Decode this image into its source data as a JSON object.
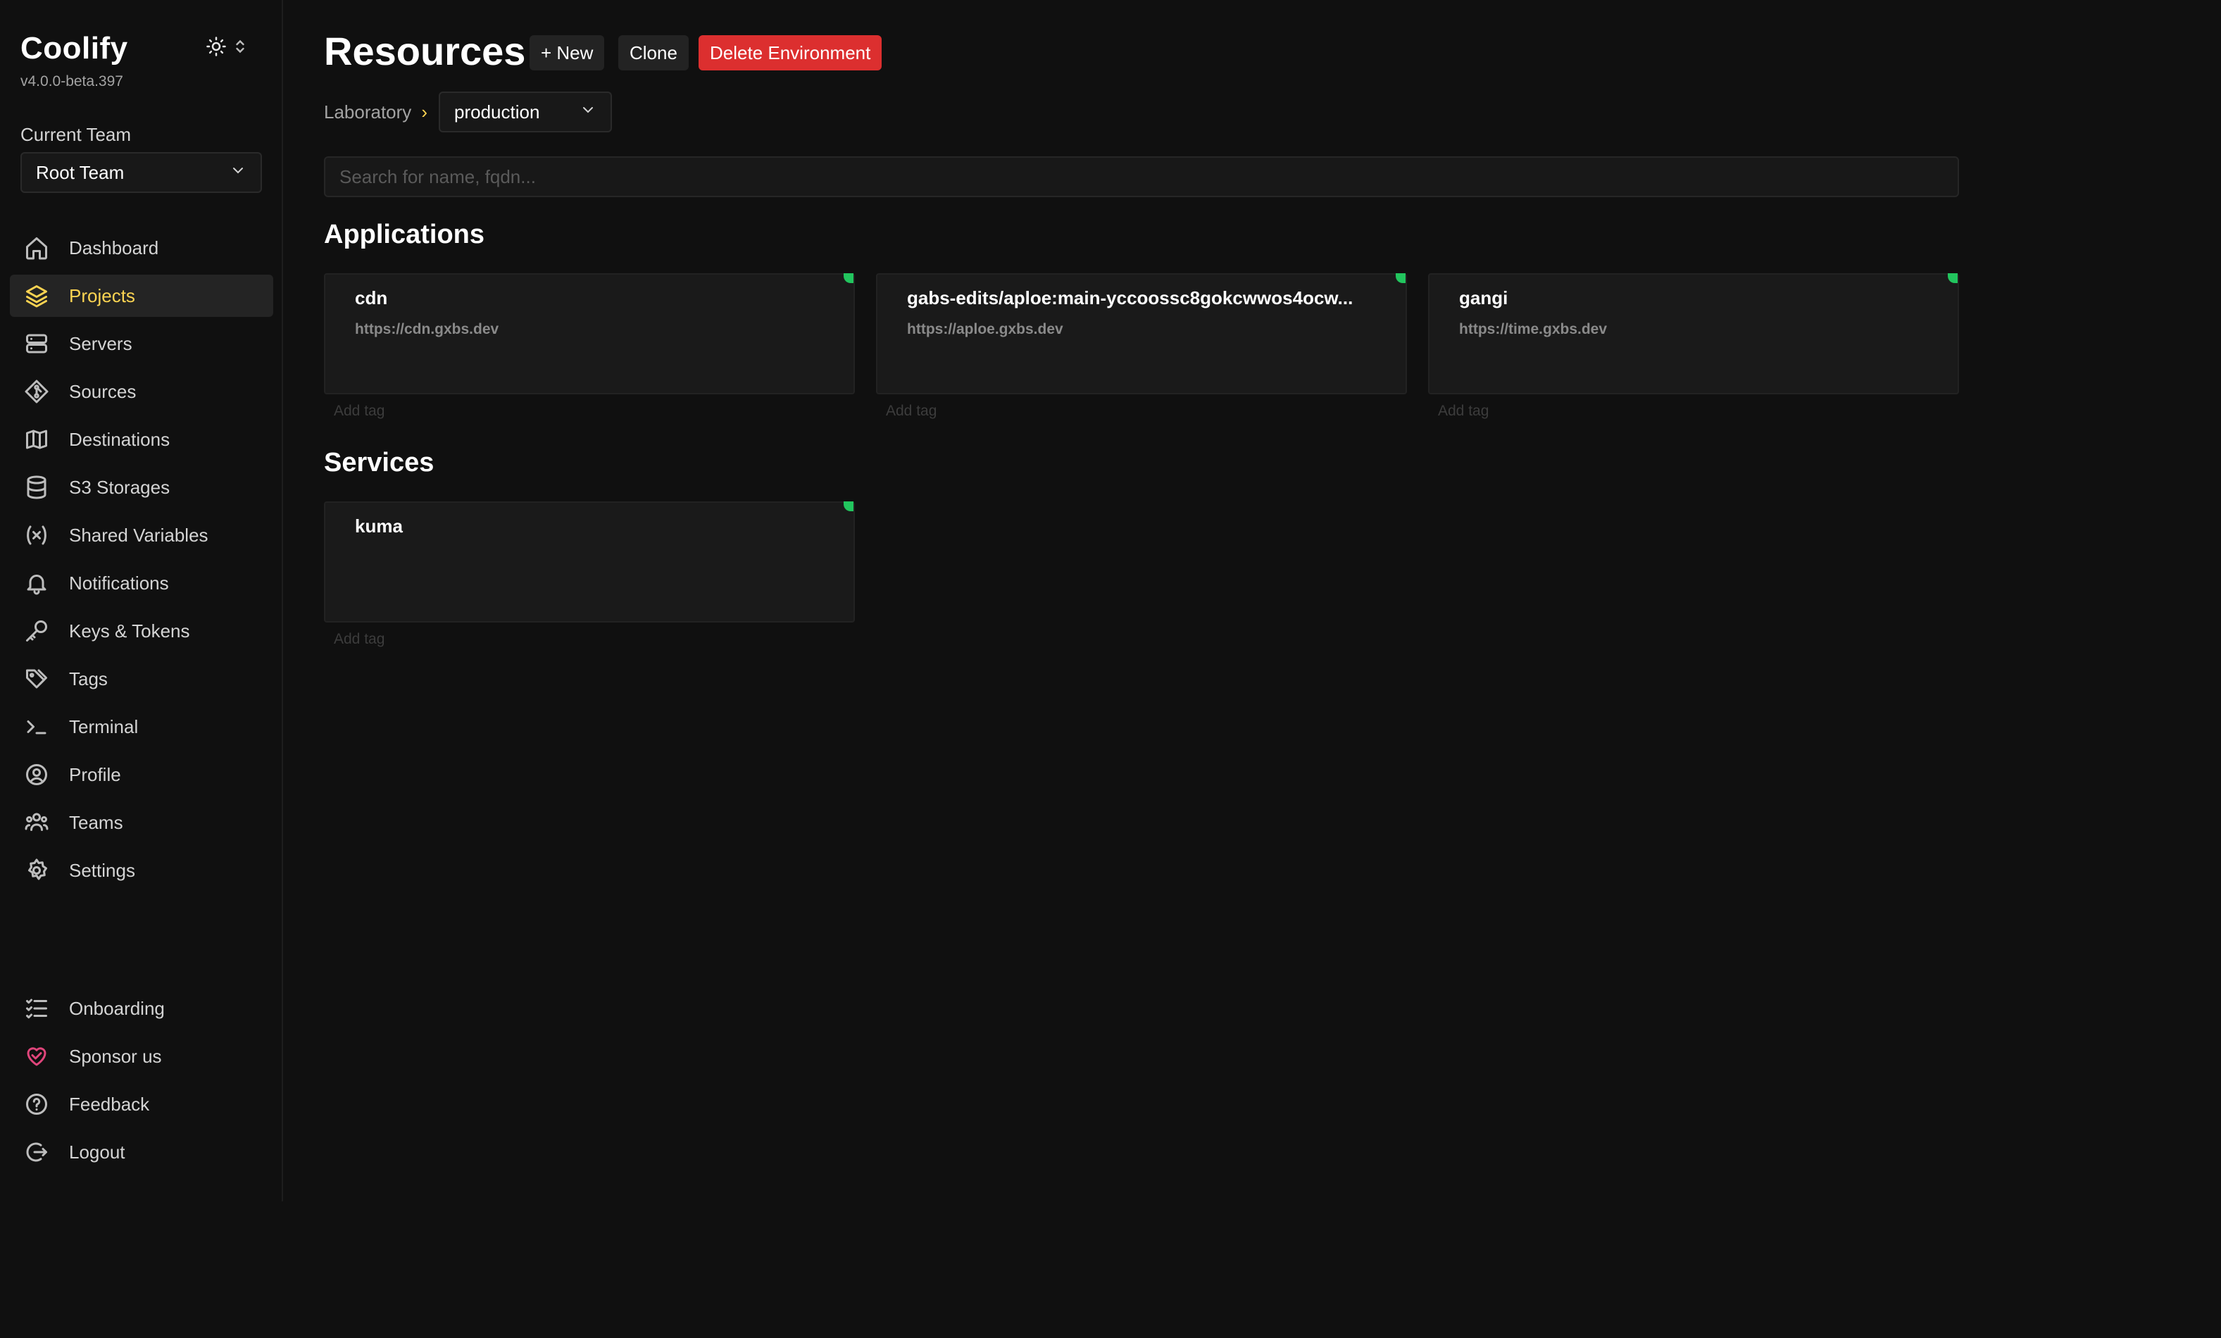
{
  "app": {
    "name": "Coolify",
    "version": "v4.0.0-beta.397"
  },
  "team": {
    "label": "Current Team",
    "selected": "Root Team"
  },
  "nav": {
    "items": [
      {
        "label": "Dashboard",
        "icon": "home-icon"
      },
      {
        "label": "Projects",
        "icon": "layers-icon",
        "active": true
      },
      {
        "label": "Servers",
        "icon": "server-icon"
      },
      {
        "label": "Sources",
        "icon": "git-icon"
      },
      {
        "label": "Destinations",
        "icon": "map-icon"
      },
      {
        "label": "S3 Storages",
        "icon": "database-icon"
      },
      {
        "label": "Shared Variables",
        "icon": "variable-icon"
      },
      {
        "label": "Notifications",
        "icon": "bell-icon"
      },
      {
        "label": "Keys & Tokens",
        "icon": "key-icon"
      },
      {
        "label": "Tags",
        "icon": "tag-icon"
      },
      {
        "label": "Terminal",
        "icon": "terminal-icon"
      },
      {
        "label": "Profile",
        "icon": "user-circle-icon"
      },
      {
        "label": "Teams",
        "icon": "users-icon"
      },
      {
        "label": "Settings",
        "icon": "gear-icon"
      }
    ],
    "bottom": [
      {
        "label": "Onboarding",
        "icon": "checklist-icon"
      },
      {
        "label": "Sponsor us",
        "icon": "heart-icon"
      },
      {
        "label": "Feedback",
        "icon": "help-icon"
      },
      {
        "label": "Logout",
        "icon": "logout-icon"
      }
    ]
  },
  "header": {
    "title": "Resources",
    "new_label": "+ New",
    "clone_label": "Clone",
    "delete_label": "Delete Environment"
  },
  "breadcrumb": {
    "project": "Laboratory",
    "separator": "›",
    "environment": "production"
  },
  "search": {
    "placeholder": "Search for name, fqdn..."
  },
  "applications": {
    "title": "Applications",
    "items": [
      {
        "name": "cdn",
        "url": "https://cdn.gxbs.dev",
        "tag_placeholder": "Add tag",
        "status": "running"
      },
      {
        "name": "gabs-edits/aploe:main-yccoossc8gokcwwos4ocw...",
        "url": "https://aploe.gxbs.dev",
        "tag_placeholder": "Add tag",
        "status": "running"
      },
      {
        "name": "gangi",
        "url": "https://time.gxbs.dev",
        "tag_placeholder": "Add tag",
        "status": "running"
      }
    ]
  },
  "services": {
    "title": "Services",
    "items": [
      {
        "name": "kuma",
        "tag_placeholder": "Add tag",
        "status": "running"
      }
    ]
  },
  "colors": {
    "accent": "#fcd452",
    "danger": "#dc2f2f",
    "status_running": "#22c55e",
    "sponsor": "#e0457b"
  }
}
